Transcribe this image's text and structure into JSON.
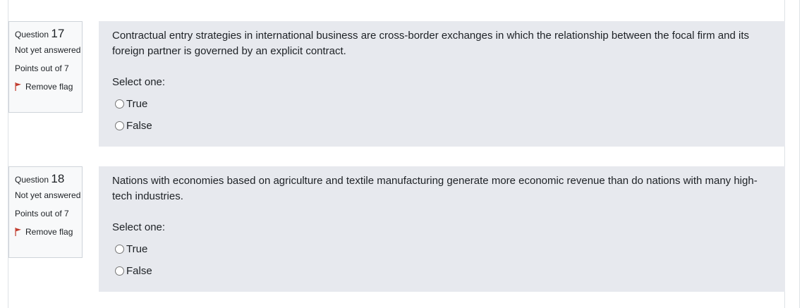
{
  "questions": [
    {
      "label": "Question",
      "number": "17",
      "state": "Not yet answered",
      "grade": "Points out of 7",
      "flag_label": "Remove flag",
      "text": "Contractual entry strategies in international business are cross-border exchanges in which the relationship between the focal firm and its foreign partner is governed by an explicit contract.",
      "prompt": "Select one:",
      "options": [
        "True",
        "False"
      ]
    },
    {
      "label": "Question",
      "number": "18",
      "state": "Not yet answered",
      "grade": "Points out of 7",
      "flag_label": "Remove flag",
      "text": "Nations with economies based on agriculture and textile manufacturing generate more economic revenue than do nations with many high-tech industries.",
      "prompt": "Select one:",
      "options": [
        "True",
        "False"
      ]
    }
  ],
  "colors": {
    "flag": "#c0392b",
    "content_bg": "#e7e9ee",
    "info_bg": "#f8f9fa"
  },
  "icons": {
    "flag": "flag-icon"
  }
}
